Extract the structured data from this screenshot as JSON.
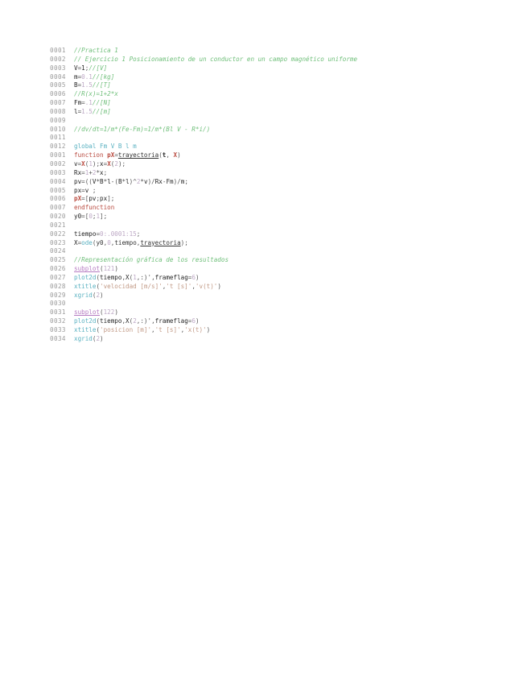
{
  "editor": {
    "lines": [
      {
        "n": "0001",
        "tokens": [
          [
            "//Practica 1",
            "comment"
          ]
        ]
      },
      {
        "n": "0002",
        "tokens": [
          [
            "// Ejercicio 1 Posicionamiento de un conductor en un campo magnético uniforme",
            "comment"
          ]
        ]
      },
      {
        "n": "0003",
        "tokens": [
          [
            "V",
            "var"
          ],
          [
            "=",
            "op"
          ],
          [
            "1",
            "var"
          ],
          [
            ";",
            "op"
          ],
          [
            "//[V]",
            "comment"
          ]
        ]
      },
      {
        "n": "0004",
        "tokens": [
          [
            "m",
            "var"
          ],
          [
            "=",
            "op"
          ],
          [
            "0.1",
            "num"
          ],
          [
            "//[kg]",
            "comment"
          ]
        ]
      },
      {
        "n": "0005",
        "tokens": [
          [
            "B",
            "var"
          ],
          [
            "=",
            "op"
          ],
          [
            "1.5",
            "num"
          ],
          [
            "//[T]",
            "comment"
          ]
        ]
      },
      {
        "n": "0006",
        "tokens": [
          [
            "//R(x)=1+2*x",
            "comment"
          ]
        ]
      },
      {
        "n": "0007",
        "tokens": [
          [
            "Fm",
            "var"
          ],
          [
            "=",
            "op"
          ],
          [
            ".1",
            "num"
          ],
          [
            "//[N]",
            "comment"
          ]
        ]
      },
      {
        "n": "0008",
        "tokens": [
          [
            "l",
            "var"
          ],
          [
            "=",
            "op"
          ],
          [
            "1.5",
            "num"
          ],
          [
            "//[m]",
            "comment"
          ]
        ]
      },
      {
        "n": "0009",
        "tokens": []
      },
      {
        "n": "0010",
        "tokens": [
          [
            "//dv/dt=1/m*(Fe-Fm)=1/m*(Bl V - R*i/)",
            "comment"
          ]
        ]
      },
      {
        "n": "0011",
        "tokens": []
      },
      {
        "n": "0012",
        "tokens": [
          [
            "global Fm V B l m",
            "fn"
          ]
        ]
      },
      {
        "n": "0001",
        "tokens": [
          [
            "function ",
            "key"
          ],
          [
            "pX",
            "boldred"
          ],
          [
            "=",
            "op"
          ],
          [
            "trayectoria",
            "mfn"
          ],
          [
            "(",
            "op"
          ],
          [
            "t",
            "bold"
          ],
          [
            ", ",
            "op"
          ],
          [
            "X",
            "boldred"
          ],
          [
            ")",
            "op"
          ]
        ]
      },
      {
        "n": "0002",
        "tokens": [
          [
            "v",
            "var"
          ],
          [
            "=",
            "op"
          ],
          [
            "X",
            "boldred"
          ],
          [
            "(",
            "op"
          ],
          [
            "1",
            "num"
          ],
          [
            ")",
            "op"
          ],
          [
            ";",
            "op"
          ],
          [
            "x",
            "var"
          ],
          [
            "=",
            "op"
          ],
          [
            "X",
            "boldred"
          ],
          [
            "(",
            "op"
          ],
          [
            "2",
            "num"
          ],
          [
            ")",
            "op"
          ],
          [
            ";",
            "op"
          ]
        ]
      },
      {
        "n": "0003",
        "tokens": [
          [
            "Rx",
            "var"
          ],
          [
            "=",
            "op"
          ],
          [
            "1",
            "num"
          ],
          [
            "+",
            "op"
          ],
          [
            "2",
            "num"
          ],
          [
            "*",
            "op"
          ],
          [
            "x",
            "var"
          ],
          [
            ";",
            "op"
          ]
        ]
      },
      {
        "n": "0004",
        "tokens": [
          [
            "pv",
            "var"
          ],
          [
            "=",
            "op"
          ],
          [
            "((",
            "op"
          ],
          [
            "V",
            "var"
          ],
          [
            "*",
            "op"
          ],
          [
            "B",
            "var"
          ],
          [
            "*",
            "op"
          ],
          [
            "l",
            "var"
          ],
          [
            "-(",
            "op"
          ],
          [
            "B",
            "var"
          ],
          [
            "*",
            "op"
          ],
          [
            "l",
            "var"
          ],
          [
            ")^",
            "op"
          ],
          [
            "2",
            "num"
          ],
          [
            "*",
            "op"
          ],
          [
            "v",
            "var"
          ],
          [
            ")/",
            "op"
          ],
          [
            "Rx",
            "var"
          ],
          [
            "-",
            "op"
          ],
          [
            "Fm",
            "var"
          ],
          [
            ")/",
            "op"
          ],
          [
            "m",
            "var"
          ],
          [
            ";",
            "op"
          ]
        ]
      },
      {
        "n": "0005",
        "tokens": [
          [
            "px",
            "var"
          ],
          [
            "=",
            "op"
          ],
          [
            "v",
            "var"
          ],
          [
            " ;",
            "op"
          ]
        ]
      },
      {
        "n": "0006",
        "tokens": [
          [
            "pX",
            "boldred"
          ],
          [
            "=[",
            "op"
          ],
          [
            "pv",
            "var"
          ],
          [
            ";",
            "op"
          ],
          [
            "px",
            "var"
          ],
          [
            "];",
            "op"
          ]
        ]
      },
      {
        "n": "0007",
        "tokens": [
          [
            "endfunction",
            "key"
          ]
        ]
      },
      {
        "n": "0020",
        "tokens": [
          [
            "y0",
            "var"
          ],
          [
            "=[",
            "op"
          ],
          [
            "0",
            "num"
          ],
          [
            ";",
            "op"
          ],
          [
            "1",
            "num"
          ],
          [
            "];",
            "op"
          ]
        ]
      },
      {
        "n": "0021",
        "tokens": []
      },
      {
        "n": "0022",
        "tokens": [
          [
            "tiempo",
            "var"
          ],
          [
            "=",
            "op"
          ],
          [
            "0:.0001:15",
            "num"
          ],
          [
            ";",
            "op"
          ]
        ]
      },
      {
        "n": "0023",
        "tokens": [
          [
            "X",
            "var"
          ],
          [
            "=",
            "op"
          ],
          [
            "ode",
            "fn"
          ],
          [
            "(",
            "op"
          ],
          [
            "y0",
            "plain"
          ],
          [
            ",",
            "op"
          ],
          [
            "0",
            "num"
          ],
          [
            ",",
            "op"
          ],
          [
            "tiempo",
            "plain"
          ],
          [
            ",",
            "op"
          ],
          [
            "trayectoria",
            "mfn"
          ],
          [
            ");",
            "op"
          ]
        ]
      },
      {
        "n": "0024",
        "tokens": []
      },
      {
        "n": "0025",
        "tokens": [
          [
            "//Representación gráfica de los resultados",
            "comment"
          ]
        ]
      },
      {
        "n": "0026",
        "tokens": [
          [
            "subplot",
            "macro"
          ],
          [
            "(",
            "op"
          ],
          [
            "121",
            "num"
          ],
          [
            ")",
            "op"
          ]
        ]
      },
      {
        "n": "0027",
        "tokens": [
          [
            "plot2d",
            "fn"
          ],
          [
            "(",
            "op"
          ],
          [
            "tiempo",
            "var"
          ],
          [
            ",",
            "op"
          ],
          [
            "X",
            "var"
          ],
          [
            "(",
            "op"
          ],
          [
            "1",
            "num"
          ],
          [
            ",:)",
            "op"
          ],
          [
            "'",
            "op"
          ],
          [
            ",",
            "op"
          ],
          [
            "frameflag",
            "var"
          ],
          [
            "=",
            "op"
          ],
          [
            "6",
            "num"
          ],
          [
            ")",
            "op"
          ]
        ]
      },
      {
        "n": "0028",
        "tokens": [
          [
            "xtitle",
            "fn"
          ],
          [
            "(",
            "op"
          ],
          [
            "'velocidad [m/s]'",
            "str"
          ],
          [
            ",",
            "op"
          ],
          [
            "'t [s]'",
            "str"
          ],
          [
            ",",
            "op"
          ],
          [
            "'v(t)'",
            "str"
          ],
          [
            ")",
            "op"
          ]
        ]
      },
      {
        "n": "0029",
        "tokens": [
          [
            "xgrid",
            "fn"
          ],
          [
            "(",
            "op"
          ],
          [
            "2",
            "num"
          ],
          [
            ")",
            "op"
          ]
        ]
      },
      {
        "n": "0030",
        "tokens": []
      },
      {
        "n": "0031",
        "tokens": [
          [
            "subplot",
            "macro"
          ],
          [
            "(",
            "op"
          ],
          [
            "122",
            "num"
          ],
          [
            ")",
            "op"
          ]
        ]
      },
      {
        "n": "0032",
        "tokens": [
          [
            "plot2d",
            "fn"
          ],
          [
            "(",
            "op"
          ],
          [
            "tiempo",
            "var"
          ],
          [
            ",",
            "op"
          ],
          [
            "X",
            "var"
          ],
          [
            "(",
            "op"
          ],
          [
            "2",
            "num"
          ],
          [
            ",:)",
            "op"
          ],
          [
            "'",
            "op"
          ],
          [
            ",",
            "op"
          ],
          [
            "frameflag",
            "var"
          ],
          [
            "=",
            "op"
          ],
          [
            "6",
            "num"
          ],
          [
            ")",
            "op"
          ]
        ]
      },
      {
        "n": "0033",
        "tokens": [
          [
            "xtitle",
            "fn"
          ],
          [
            "(",
            "op"
          ],
          [
            "'posicion [m]'",
            "str"
          ],
          [
            ",",
            "op"
          ],
          [
            "'t [s]'",
            "str"
          ],
          [
            ",",
            "op"
          ],
          [
            "'x(t)'",
            "str"
          ],
          [
            ")",
            "op"
          ]
        ]
      },
      {
        "n": "0034",
        "tokens": [
          [
            "xgrid",
            "fn"
          ],
          [
            "(",
            "op"
          ],
          [
            "2",
            "num"
          ],
          [
            ")",
            "op"
          ]
        ]
      }
    ]
  },
  "colors": {
    "comment": "#6fbf7a",
    "number": "#bca7c4",
    "keyword": "#b94a3f",
    "builtin": "#5ab1c1",
    "string": "#c29a86",
    "macro": "#b67cc2",
    "line_number": "#9a9a9a"
  }
}
